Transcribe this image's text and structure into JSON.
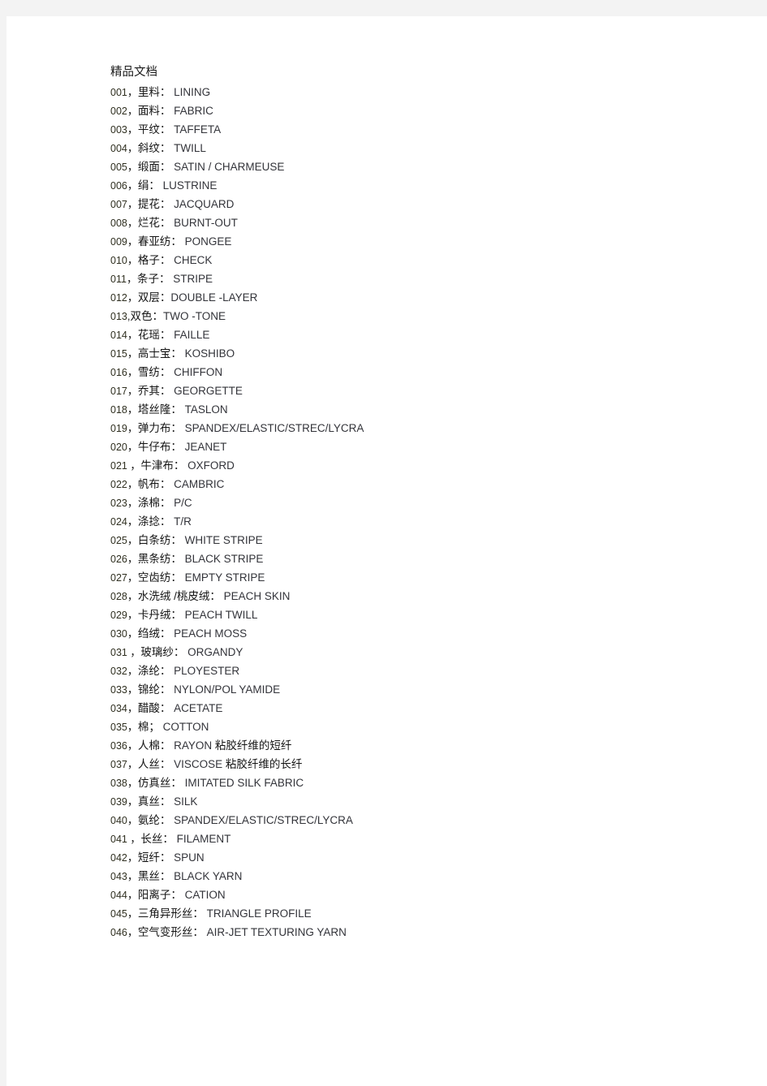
{
  "document": {
    "heading": "精品文档",
    "entries": [
      {
        "num": "001",
        "sep": "，",
        "cn": "里料",
        "colon": "：",
        "en": " LINING",
        "note": ""
      },
      {
        "num": "002",
        "sep": "，",
        "cn": "面料",
        "colon": "：",
        "en": " FABRIC",
        "note": ""
      },
      {
        "num": "003",
        "sep": "，",
        "cn": "平纹",
        "colon": "：",
        "en": " TAFFETA",
        "note": ""
      },
      {
        "num": "004",
        "sep": "，",
        "cn": "斜纹",
        "colon": "：",
        "en": " TWILL",
        "note": ""
      },
      {
        "num": "005",
        "sep": "，",
        "cn": "缎面",
        "colon": "：",
        "en": " SATIN / CHARMEUSE",
        "note": ""
      },
      {
        "num": "006",
        "sep": "，",
        "cn": "绢",
        "colon": "：",
        "en": " LUSTRINE",
        "note": ""
      },
      {
        "num": "007",
        "sep": "，",
        "cn": "提花",
        "colon": "：",
        "en": " JACQUARD",
        "note": ""
      },
      {
        "num": "008",
        "sep": "，",
        "cn": "烂花",
        "colon": "：",
        "en": " BURNT-OUT",
        "note": ""
      },
      {
        "num": "009",
        "sep": "，",
        "cn": "春亚纺",
        "colon": "：",
        "en": " PONGEE",
        "note": ""
      },
      {
        "num": "010",
        "sep": "，",
        "cn": "格子",
        "colon": "：",
        "en": " CHECK",
        "note": ""
      },
      {
        "num": "011",
        "sep": "，",
        "cn": "条子",
        "colon": "：",
        "en": " STRIPE",
        "note": ""
      },
      {
        "num": "012",
        "sep": "，",
        "cn": "双层",
        "colon": "：",
        "en": "DOUBLE -LAYER",
        "note": ""
      },
      {
        "num": "013",
        "sep": ",",
        "cn": "双色",
        "colon": "：",
        "en": "TWO -TONE",
        "note": ""
      },
      {
        "num": "014",
        "sep": "，",
        "cn": "花瑶",
        "colon": "：",
        "en": " FAILLE",
        "note": ""
      },
      {
        "num": "015",
        "sep": "，",
        "cn": "高士宝",
        "colon": "：",
        "en": " KOSHIBO",
        "note": ""
      },
      {
        "num": "016",
        "sep": "，",
        "cn": "雪纺",
        "colon": "：",
        "en": " CHIFFON",
        "note": ""
      },
      {
        "num": "017",
        "sep": "，",
        "cn": "乔其",
        "colon": "：",
        "en": " GEORGETTE",
        "note": ""
      },
      {
        "num": "018",
        "sep": "，",
        "cn": "塔丝隆",
        "colon": "：",
        "en": " TASLON",
        "note": ""
      },
      {
        "num": "019",
        "sep": "，",
        "cn": "弹力布",
        "colon": "：",
        "en": " SPANDEX/ELASTIC/STREC/LYCRA",
        "note": ""
      },
      {
        "num": "020",
        "sep": "，",
        "cn": "牛仔布",
        "colon": "：",
        "en": " JEANET",
        "note": ""
      },
      {
        "num": "021 ",
        "sep": "，",
        "cn": "牛津布",
        "colon": "：",
        "en": " OXFORD",
        "note": ""
      },
      {
        "num": "022",
        "sep": "，",
        "cn": "帆布",
        "colon": "：",
        "en": " CAMBRIC",
        "note": ""
      },
      {
        "num": "023",
        "sep": "，",
        "cn": "涤棉",
        "colon": "：",
        "en": " P/C",
        "note": ""
      },
      {
        "num": "024",
        "sep": "，",
        "cn": "涤捻",
        "colon": "：",
        "en": " T/R",
        "note": ""
      },
      {
        "num": "025",
        "sep": "，",
        "cn": "白条纺",
        "colon": "：",
        "en": " WHITE STRIPE",
        "note": ""
      },
      {
        "num": "026",
        "sep": "，",
        "cn": "黑条纺",
        "colon": "：",
        "en": " BLACK STRIPE",
        "note": ""
      },
      {
        "num": "027",
        "sep": "，",
        "cn": "空齿纺",
        "colon": "：",
        "en": " EMPTY STRIPE",
        "note": ""
      },
      {
        "num": "028",
        "sep": "，",
        "cn": "水洗绒 /桃皮绒",
        "colon": "：",
        "en": " PEACH SKIN",
        "note": ""
      },
      {
        "num": "029",
        "sep": "，",
        "cn": "卡丹绒",
        "colon": "：",
        "en": " PEACH TWILL",
        "note": ""
      },
      {
        "num": "030",
        "sep": "，",
        "cn": "绉绒",
        "colon": "：",
        "en": " PEACH MOSS",
        "note": ""
      },
      {
        "num": "031 ",
        "sep": "，",
        "cn": "玻璃纱",
        "colon": "：",
        "en": " ORGANDY",
        "note": ""
      },
      {
        "num": "032",
        "sep": "，",
        "cn": "涤纶",
        "colon": "：",
        "en": " PLOYESTER",
        "note": ""
      },
      {
        "num": "033",
        "sep": "，",
        "cn": "锦纶",
        "colon": "：",
        "en": " NYLON/POL YAMIDE",
        "note": ""
      },
      {
        "num": "034",
        "sep": "，",
        "cn": "醋酸",
        "colon": "：",
        "en": " ACETATE",
        "note": ""
      },
      {
        "num": "035",
        "sep": "，",
        "cn": "棉",
        "colon": "；",
        "en": " COTTON",
        "note": ""
      },
      {
        "num": "036",
        "sep": "，",
        "cn": "人棉",
        "colon": "：",
        "en": " RAYON ",
        "note": "粘胶纤维的短纤"
      },
      {
        "num": "037",
        "sep": "，",
        "cn": "人丝",
        "colon": "：",
        "en": " VISCOSE ",
        "note": "粘胶纤维的长纤"
      },
      {
        "num": "038",
        "sep": "，",
        "cn": "仿真丝",
        "colon": "：",
        "en": " IMITATED SILK FABRIC",
        "note": ""
      },
      {
        "num": "039",
        "sep": "，",
        "cn": "真丝",
        "colon": "：",
        "en": " SILK",
        "note": ""
      },
      {
        "num": "040",
        "sep": "，",
        "cn": "氨纶",
        "colon": "：",
        "en": " SPANDEX/ELASTIC/STREC/LYCRA",
        "note": ""
      },
      {
        "num": "041 ",
        "sep": "，",
        "cn": "长丝",
        "colon": "：",
        "en": " FILAMENT",
        "note": ""
      },
      {
        "num": "042",
        "sep": "，",
        "cn": "短纤",
        "colon": "：",
        "en": " SPUN",
        "note": ""
      },
      {
        "num": "043",
        "sep": "，",
        "cn": "黑丝",
        "colon": "：",
        "en": " BLACK YARN",
        "note": ""
      },
      {
        "num": "044",
        "sep": "，",
        "cn": "阳离子",
        "colon": "：",
        "en": " CATION",
        "note": ""
      },
      {
        "num": "045",
        "sep": "，",
        "cn": "三角异形丝",
        "colon": "：",
        "en": " TRIANGLE PROFILE",
        "note": ""
      },
      {
        "num": "046",
        "sep": "，",
        "cn": "空气变形丝",
        "colon": "：",
        "en": " AIR-JET TEXTURING YARN",
        "note": ""
      }
    ]
  }
}
